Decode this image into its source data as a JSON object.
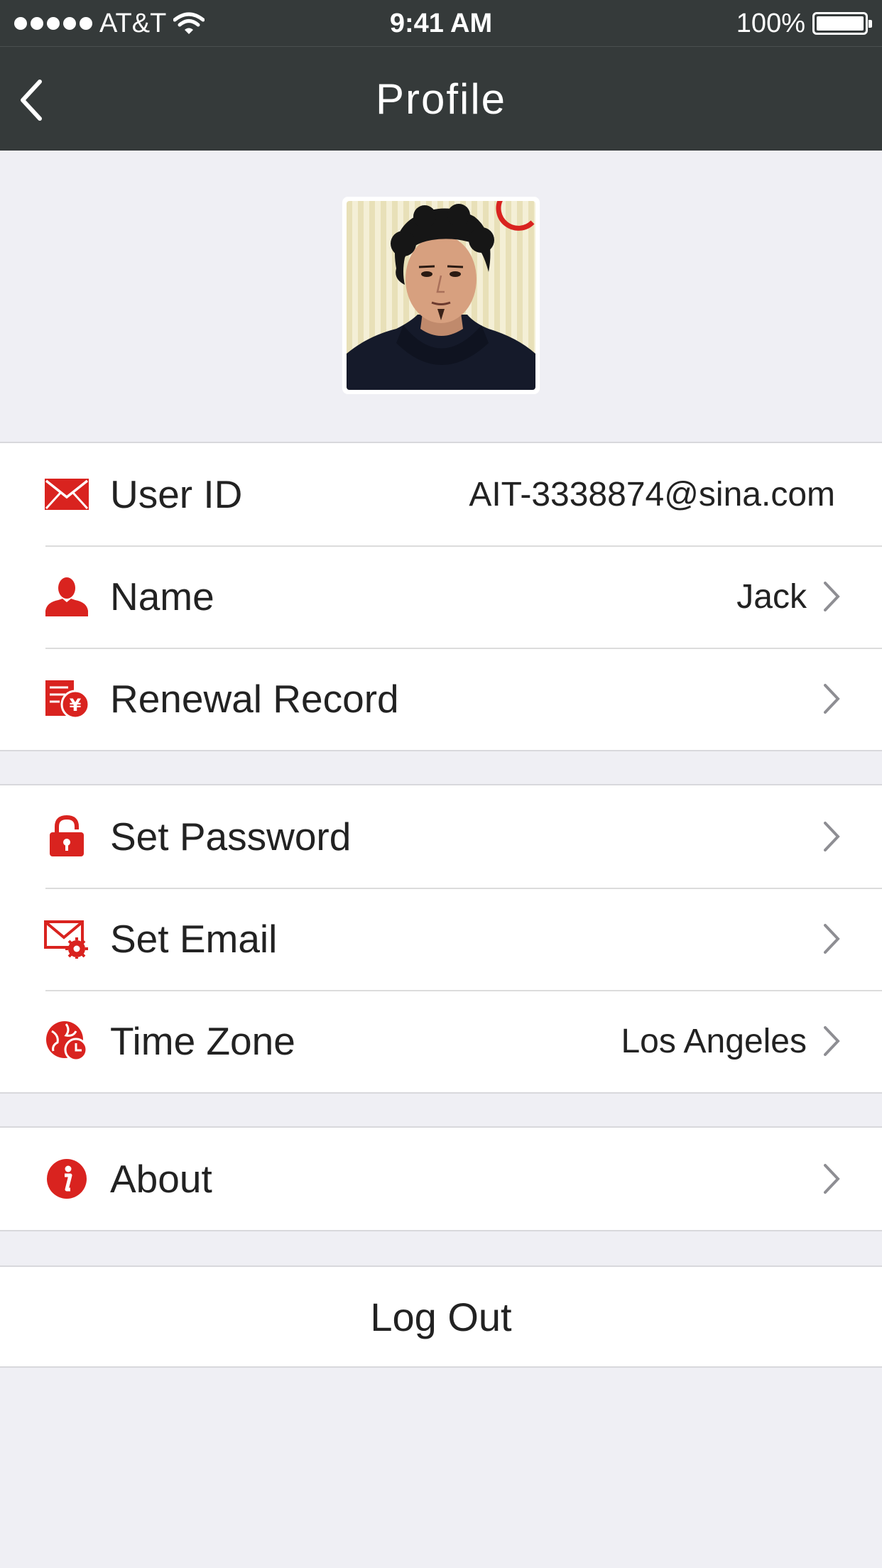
{
  "status": {
    "carrier": "AT&T",
    "time": "9:41 AM",
    "battery": "100%"
  },
  "nav": {
    "title": "Profile",
    "back_icon": "chevron-left-icon"
  },
  "avatar": {
    "alt": "profile photo"
  },
  "account": {
    "user_id_label": "User ID",
    "user_id_value": "AIT-3338874@sina.com",
    "name_label": "Name",
    "name_value": "Jack",
    "renewal_label": "Renewal Record"
  },
  "settings": {
    "password_label": "Set Password",
    "email_label": "Set Email",
    "timezone_label": "Time Zone",
    "timezone_value": "Los Angeles"
  },
  "about": {
    "label": "About"
  },
  "logout": {
    "label": "Log Out"
  },
  "colors": {
    "nav_bg": "#353a3a",
    "accent": "#d9231f",
    "page_bg": "#efeff4"
  }
}
